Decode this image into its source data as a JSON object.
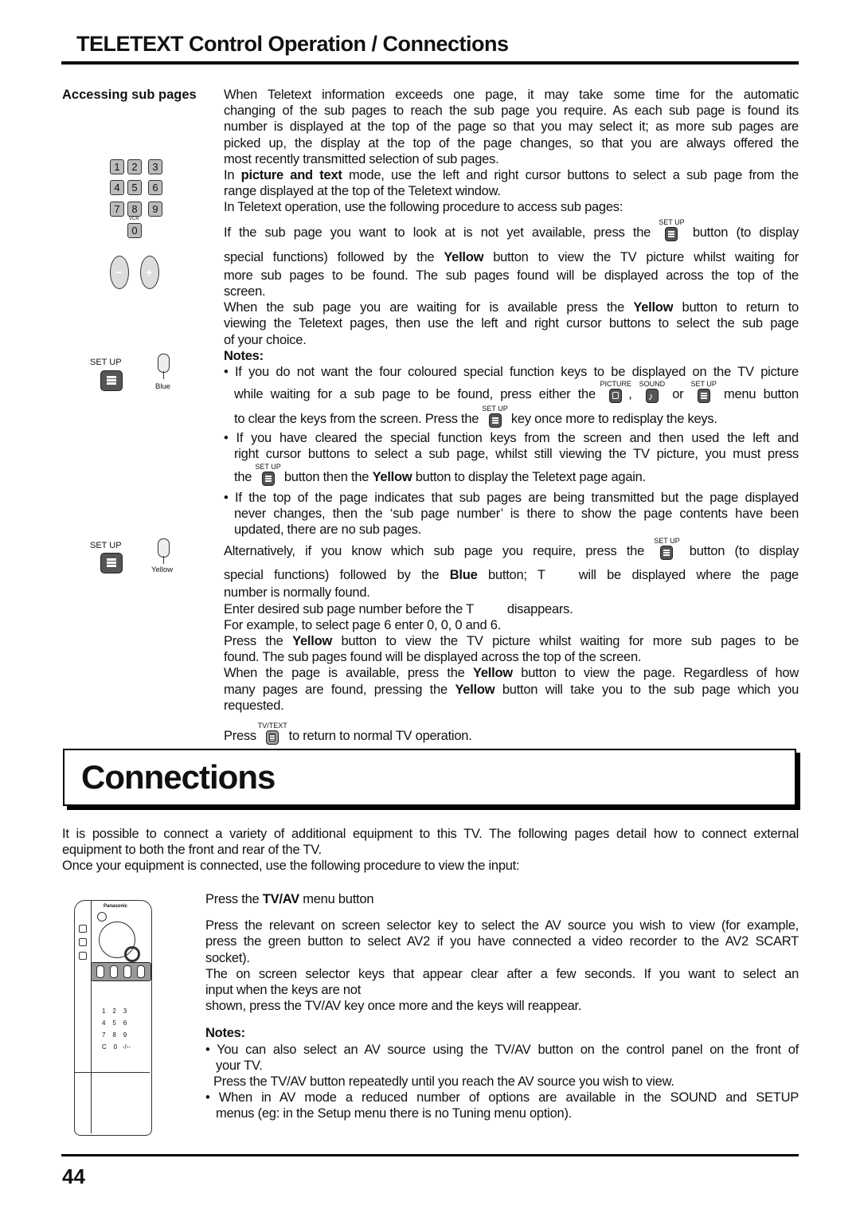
{
  "header": {
    "title": "TELETEXT Control Operation / Connections"
  },
  "sub_pages": {
    "section_label": "Accessing sub pages",
    "intro_lines": [
      "When Teletext information exceeds one page, it may take some time for the automatic",
      "changing of the sub pages to reach the sub page you require. As each sub page is found its",
      "number is displayed at the top of the page so that you may select it; as more sub pages are",
      "picked up, the display at the top of the page changes, so that you are always offered the",
      "most recently transmitted selection of sub pages."
    ],
    "pt_mode_prefix": "In ",
    "pt_mode_bold": "picture and text",
    "pt_mode_line1": " mode, use the left and right cursor buttons to select a sub page from the",
    "pt_mode_line2": "range displayed at the top of the Teletext window.",
    "procedure_intro": "In Teletext operation, use the following procedure to access sub pages:",
    "step1_before": "If the sub page you want to look at is not yet available, press the",
    "step1_after": "button (to display",
    "step1_line2_a": "special functions) followed by the ",
    "step1_line2_bold": "Yellow",
    "step1_line2_b": " button to view the TV picture whilst waiting for",
    "step1_line3": "more sub pages to be found. The sub pages found will be displayed across the top of the",
    "step1_line4": "screen.",
    "step2_line1_a": "When the sub page you are waiting for is available press the ",
    "step2_line1_bold": "Yellow",
    "step2_line1_b": " button to return to",
    "step2_line2": "viewing the Teletext pages, then use the left and right cursor buttons to select the sub page",
    "step2_line3": "of your choice.",
    "notes_title": "Notes:",
    "note1_line1": "• If you do not want the four coloured special function keys to be displayed on the TV picture",
    "note1_line2_a": "while waiting for a sub page to be found, press either the",
    "note1_line2_sep1": ",",
    "note1_line2_sep2": "or",
    "note1_line2_b": "menu button",
    "note1_line3_a": "to clear the keys from the screen. Press the",
    "note1_line3_b": "key once more to redisplay the keys.",
    "note2_line1": "• If you have cleared the special function keys from the screen and then used the left and",
    "note2_line2": "right cursor buttons to select a sub page, whilst still viewing the TV picture, you must press",
    "note2_line3_a": "the",
    "note2_line3_b": "button then the ",
    "note2_line3_bold": "Yellow",
    "note2_line3_c": " button to display the Teletext page again.",
    "note3_line1": "• If the top of the page indicates that sub pages are being transmitted but the page displayed",
    "note3_line2": "never changes, then the ‘sub page number’ is there to show the page contents have been",
    "note3_line3": "updated, there are no sub pages.",
    "alt_line1_a": "Alternatively, if you know which sub page you require, press the",
    "alt_line1_b": "button (to display",
    "alt_line2_a": "special functions) followed by the ",
    "alt_line2_bold": "Blue",
    "alt_line2_b": " button; T",
    "alt_line2_c": "will be displayed where the page",
    "alt_line3": "number is normally found.",
    "enter_line_a": "Enter desired sub page number before the T",
    "enter_line_b": "disappears.",
    "example_line": "For example, to select page 6 enter 0, 0, 0 and 6.",
    "yellow1_line1_a": "Press the ",
    "yellow1_line1_bold": "Yellow",
    "yellow1_line1_b": " button to view the TV picture whilst waiting for more sub pages to be",
    "yellow1_line2": "found. The sub pages found will be displayed across the top of the screen.",
    "yellow2_line1_a": "When the page is available, press the ",
    "yellow2_line1_bold": "Yellow",
    "yellow2_line1_b": " button to view the page. Regardless of how",
    "yellow2_line2_a": "many pages are found, pressing the ",
    "yellow2_line2_bold": "Yellow",
    "yellow2_line2_b": " button will take you to the sub page which you",
    "yellow2_line3": "requested.",
    "press_a": "Press",
    "press_b": "to return to normal TV operation."
  },
  "button_captions": {
    "setup": "SET UP",
    "picture": "PICTURE",
    "sound": "SOUND",
    "tvtext": "TV/TEXT",
    "vcr": "VCR",
    "blue": "Blue",
    "yellow": "Yellow",
    "brand": "Panasonic"
  },
  "keypad": {
    "keys": [
      "1",
      "2",
      "3",
      "4",
      "5",
      "6",
      "7",
      "8",
      "9",
      "0"
    ],
    "minus": "−",
    "plus": "+"
  },
  "remote": {
    "keys": [
      "1",
      "2",
      "3",
      "4",
      "5",
      "6",
      "7",
      "8",
      "9",
      "C",
      "0",
      "-/--"
    ]
  },
  "connections": {
    "title": "Connections",
    "intro_line1": "It is possible to connect a variety of additional equipment to this TV. The following pages detail how to connect external",
    "intro_line2": "equipment to both the front and rear of the TV.",
    "intro_line3": "Once your equipment is connected, use the following procedure to view the input:",
    "step1_a": "Press the ",
    "step1_bold": "TV/AV",
    "step1_b": " menu button",
    "step2_lines": [
      "Press the relevant on screen selector key to select the AV source you wish to view (for example,",
      "press the green button to select AV2 if you have connected a video recorder to the AV2 SCART",
      "socket)."
    ],
    "step3_lines": [
      "The on screen selector keys that appear clear after a few seconds. If you want to select an",
      "input when the keys are not",
      "shown, press the TV/AV key once more and the keys will reappear."
    ],
    "notes_title": "Notes:",
    "note1_line1": "• You can also select an AV source using the TV/AV button on the control panel on the front of",
    "note1_line2": "your TV.",
    "note1_line3": "Press the TV/AV button repeatedly until you reach the AV source you wish to view.",
    "note2_line1": "• When in AV mode a reduced number of options are available in the SOUND and SETUP",
    "note2_line2": "menus (eg: in the Setup menu there is no Tuning menu option)."
  },
  "footer": {
    "page_number": "44"
  }
}
